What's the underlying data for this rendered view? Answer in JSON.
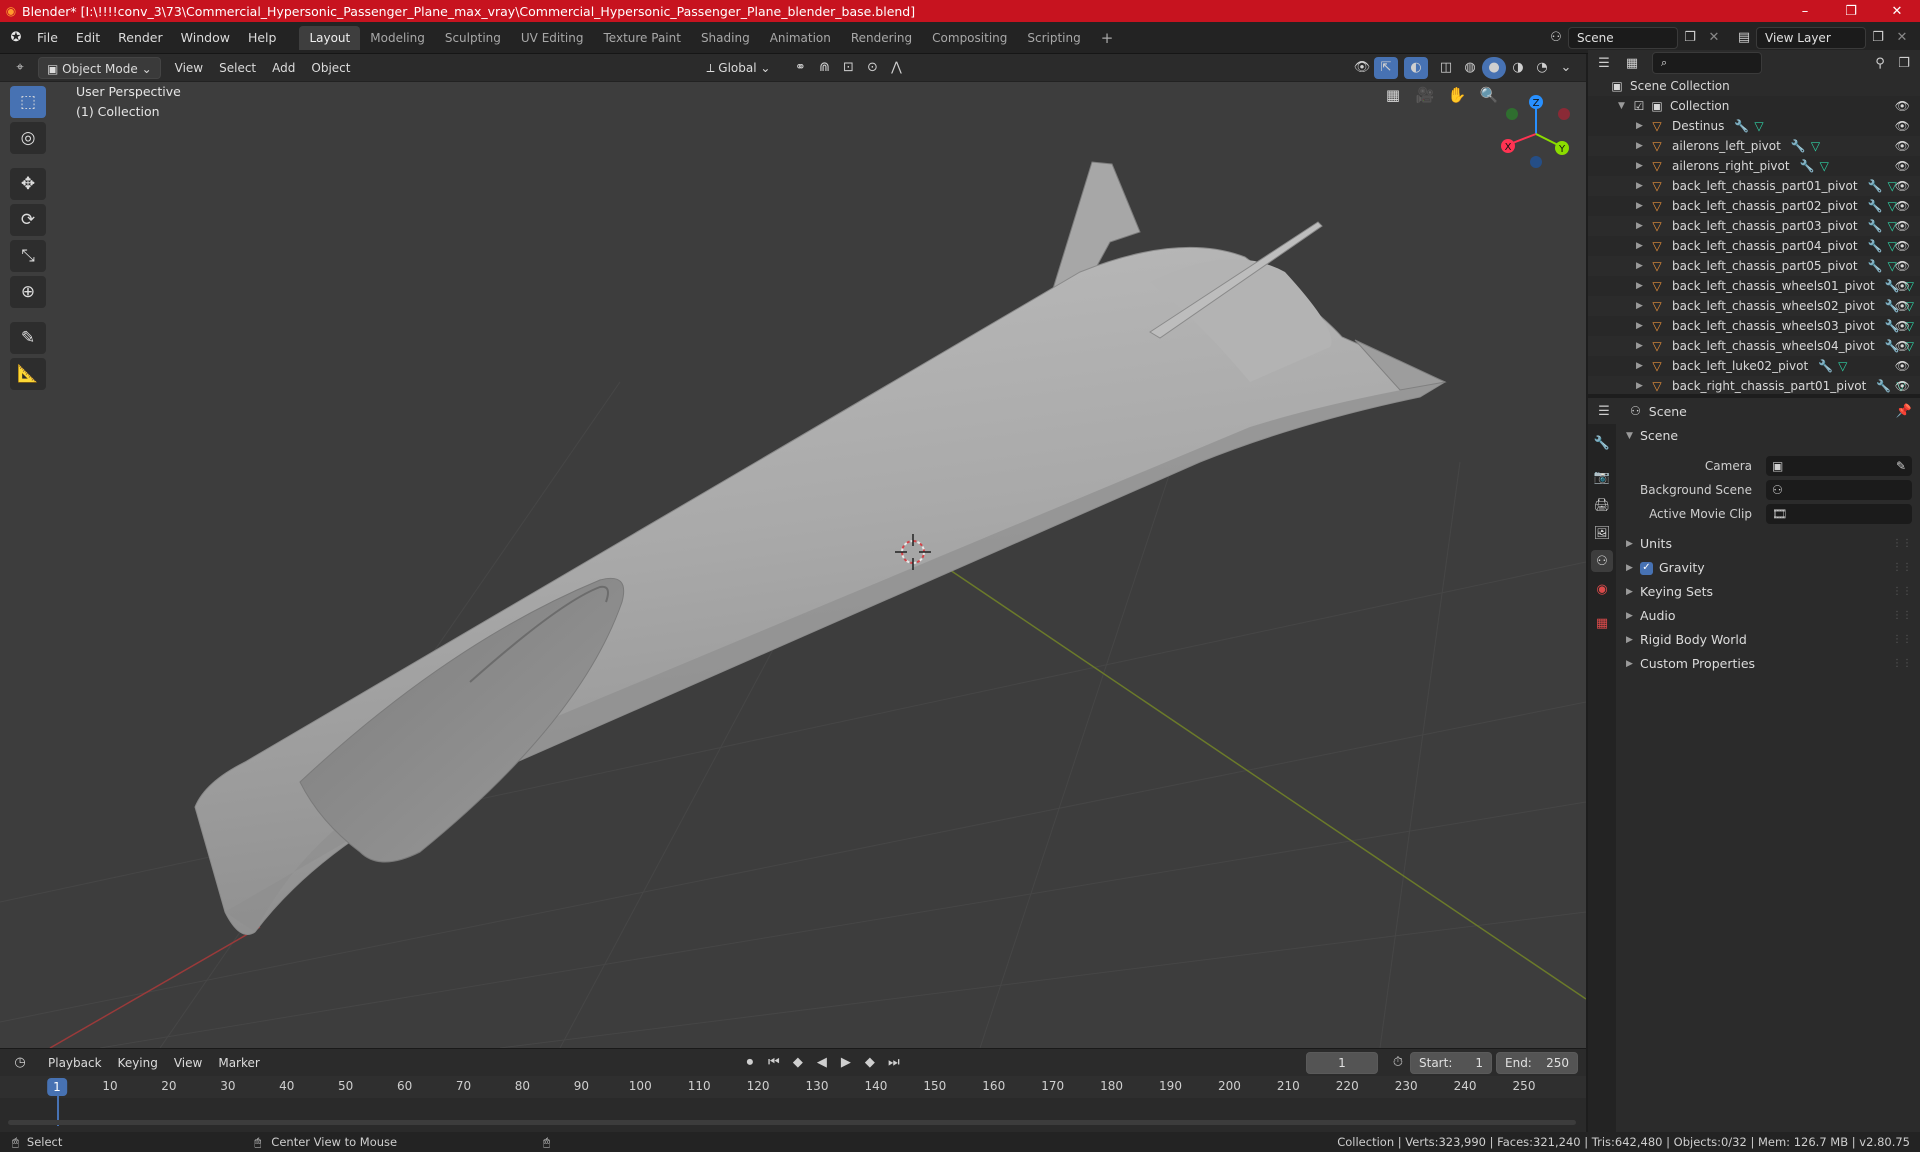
{
  "window": {
    "title": "Blender* [I:\\!!!!conv_3\\73\\Commercial_Hypersonic_Passenger_Plane_max_vray\\Commercial_Hypersonic_Passenger_Plane_blender_base.blend]",
    "minimize": "–",
    "maximize": "❐",
    "close": "✕"
  },
  "menus": [
    "File",
    "Edit",
    "Render",
    "Window",
    "Help"
  ],
  "workspaces": [
    "Layout",
    "Modeling",
    "Sculpting",
    "UV Editing",
    "Texture Paint",
    "Shading",
    "Animation",
    "Rendering",
    "Compositing",
    "Scripting"
  ],
  "active_workspace": "Layout",
  "add_workspace": "+",
  "scene_field": "Scene",
  "view_layer_field": "View Layer",
  "viewport_header": {
    "mode": "Object Mode",
    "menus": [
      "View",
      "Select",
      "Add",
      "Object"
    ],
    "transform_orientation": "Global"
  },
  "viewport": {
    "perspective_label": "User Perspective",
    "collection_label": "(1) Collection",
    "gizmo_axes": {
      "x": "X",
      "y": "Y",
      "z": "Z"
    }
  },
  "outliner": {
    "root": "Scene Collection",
    "collection": "Collection",
    "objects": [
      {
        "name": "Destinus",
        "mod": true
      },
      {
        "name": "ailerons_left_pivot",
        "mod": true
      },
      {
        "name": "ailerons_right_pivot",
        "mod": true
      },
      {
        "name": "back_left_chassis_part01_pivot",
        "mod": true
      },
      {
        "name": "back_left_chassis_part02_pivot",
        "mod": true
      },
      {
        "name": "back_left_chassis_part03_pivot",
        "mod": true
      },
      {
        "name": "back_left_chassis_part04_pivot",
        "mod": true
      },
      {
        "name": "back_left_chassis_part05_pivot",
        "mod": true
      },
      {
        "name": "back_left_chassis_wheels01_pivot",
        "mod": true
      },
      {
        "name": "back_left_chassis_wheels02_pivot",
        "mod": true
      },
      {
        "name": "back_left_chassis_wheels03_pivot",
        "mod": true
      },
      {
        "name": "back_left_chassis_wheels04_pivot",
        "mod": true
      },
      {
        "name": "back_left_luke02_pivot",
        "mod": true
      },
      {
        "name": "back_right_chassis_part01_pivot",
        "mod": true
      }
    ]
  },
  "properties": {
    "header_title": "Scene",
    "panel_title": "Scene",
    "fields": [
      {
        "label": "Camera",
        "value": ""
      },
      {
        "label": "Background Scene",
        "value": ""
      },
      {
        "label": "Active Movie Clip",
        "value": ""
      }
    ],
    "subpanels": [
      "Units",
      "Gravity",
      "Keying Sets",
      "Audio",
      "Rigid Body World",
      "Custom Properties"
    ],
    "gravity_checked": true
  },
  "timeline": {
    "menus": [
      "Playback",
      "Keying",
      "View",
      "Marker"
    ],
    "current_frame": "1",
    "start_label": "Start:",
    "start": "1",
    "end_label": "End:",
    "end": "250",
    "ticks": [
      "1",
      "10",
      "20",
      "30",
      "40",
      "50",
      "60",
      "70",
      "80",
      "90",
      "100",
      "110",
      "120",
      "130",
      "140",
      "150",
      "160",
      "170",
      "180",
      "190",
      "200",
      "210",
      "220",
      "230",
      "240",
      "250"
    ]
  },
  "statusbar": {
    "select": "Select",
    "center_view": "Center View to Mouse",
    "stats": "Collection | Verts:323,990 | Faces:321,240 | Tris:642,480 | Objects:0/32 | Mem: 126.7 MB | v2.80.75"
  },
  "colors": {
    "accent": "#4772b3",
    "titlebar": "#c7131f",
    "object_icon": "#e8903a",
    "mesh_icon": "#2fd1a4",
    "modifier_icon": "#6ba0ff",
    "axis_x": "#ff3352",
    "axis_y": "#8bdc00",
    "axis_z": "#2890ff"
  }
}
